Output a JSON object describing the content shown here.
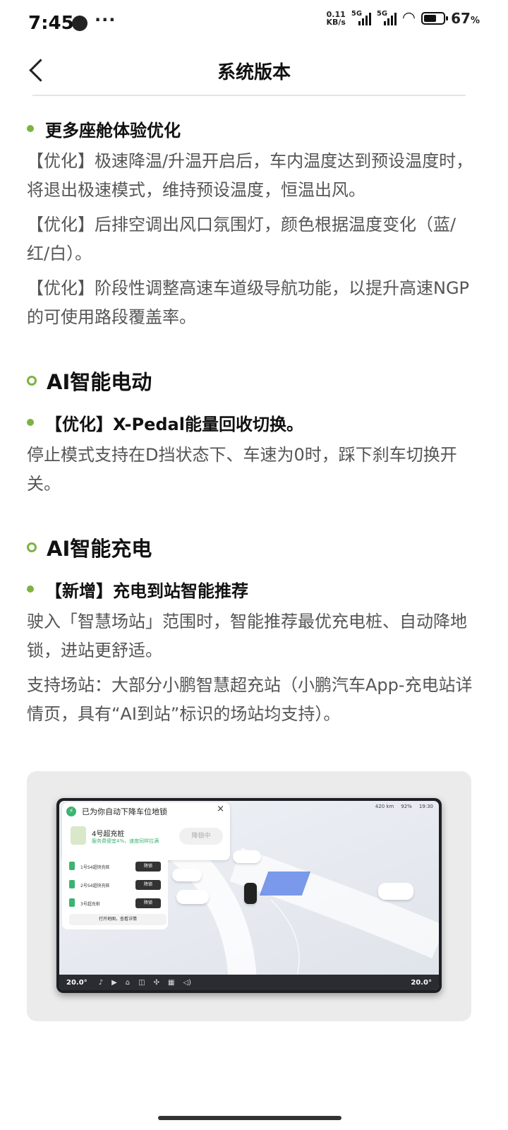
{
  "status_bar": {
    "time": "7:45",
    "net_speed_value": "0.11",
    "net_speed_unit": "KB/s",
    "signal1_label": "5G",
    "signal2_label": "5G",
    "wifi_sub": "6",
    "battery_percent": "67",
    "battery_unit": "%",
    "battery_level": 0.67
  },
  "header": {
    "title": "系统版本"
  },
  "sections": {
    "cabin": {
      "heading": "更多座舱体验优化",
      "p1": "【优化】极速降温/升温开启后，车内温度达到预设温度时，将退出极速模式，维持预设温度，恒温出风。",
      "p2": "【优化】后排空调出风口氛围灯，颜色根据温度变化（蓝/红/白）。",
      "p3": "【优化】阶段性调整高速车道级导航功能，以提升高速NGP的可使用路段覆盖率。"
    },
    "ai_drive": {
      "title": "AI智能电动",
      "heading": "【优化】X-Pedal能量回收切换。",
      "p1": "停止模式支持在D挡状态下、车速为0时，踩下刹车切换开关。"
    },
    "ai_charge": {
      "title": "AI智能充电",
      "heading": "【新增】充电到站智能推荐",
      "p1": "驶入「智慧场站」范围时，智能推荐最优充电桩、自动降地锁，进站更舒适。",
      "p2": "支持场站：大部分小鹏智慧超充站（小鹏汽车App-充电站详情页，具有“AI到站”标识的场站均支持）。"
    }
  },
  "screenshot_card": {
    "notify_title": "已为你自动下降车位地锁",
    "close": "×",
    "station_name": "4号超充桩",
    "station_desc": "服务费便宜4%，速度同样拉满",
    "unlock_label": "降锁中",
    "list": [
      {
        "name": "1号S4超快充桩",
        "btn": "降锁"
      },
      {
        "name": "2号S4超快充桩",
        "btn": "降锁"
      },
      {
        "name": "3号超充桩",
        "btn": "降锁"
      }
    ],
    "map_button": "打开地图，查看详情",
    "range": "420 km",
    "battery": "92%",
    "clock": "19:30",
    "temp_left": "20.0°",
    "temp_right": "20.0°"
  }
}
